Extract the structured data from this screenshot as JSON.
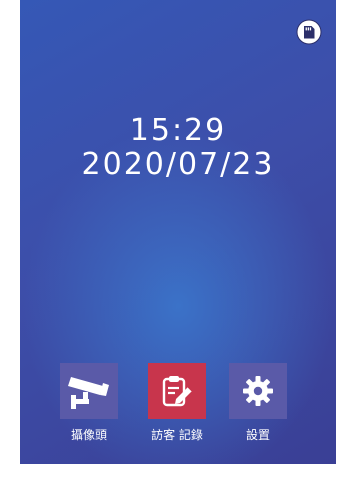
{
  "status": {
    "sd_card_icon": "sd-card-icon"
  },
  "clock": {
    "time": "15:29",
    "date": "2020/07/23"
  },
  "apps": [
    {
      "label": "攝像頭",
      "icon": "cctv-camera-icon",
      "color": "#5a5aa8"
    },
    {
      "label": "訪客 記錄",
      "icon": "visitor-log-icon",
      "color": "#c8354c"
    },
    {
      "label": "設置",
      "icon": "gear-icon",
      "color": "#5a5aa8"
    }
  ]
}
